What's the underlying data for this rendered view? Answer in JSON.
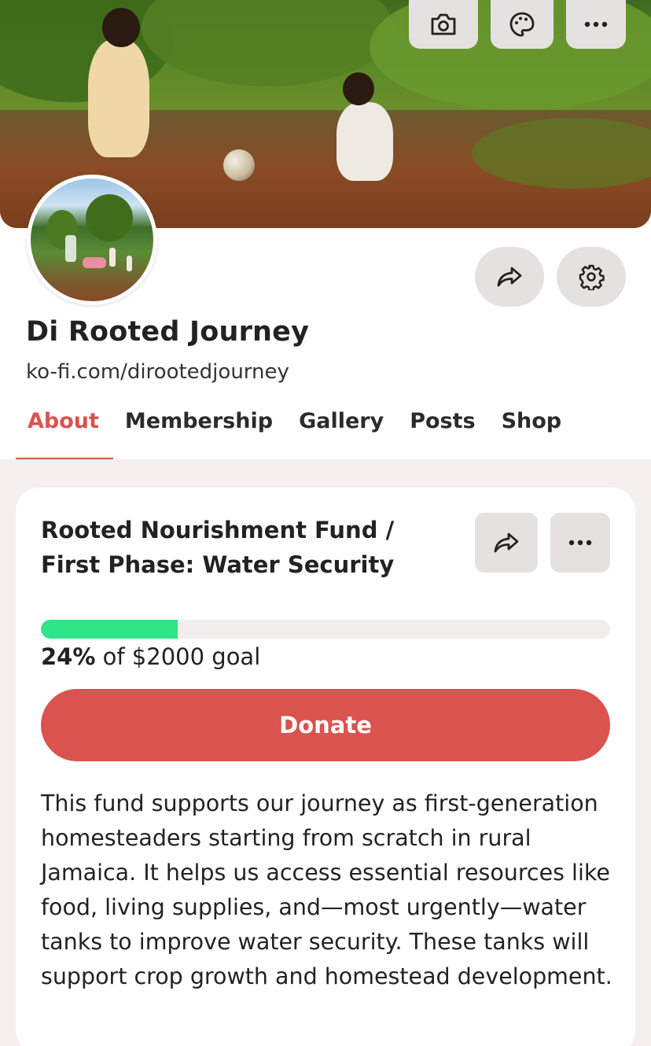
{
  "cover": {
    "actions": [
      {
        "icon": "camera-icon"
      },
      {
        "icon": "palette-icon"
      },
      {
        "icon": "more-icon"
      }
    ]
  },
  "profile": {
    "name": "Di Rooted Journey",
    "url": "ko-fi.com/dirootedjourney",
    "actions": [
      {
        "icon": "share-icon"
      },
      {
        "icon": "gear-icon"
      }
    ]
  },
  "tabs": [
    {
      "label": "About",
      "active": true
    },
    {
      "label": "Membership",
      "active": false
    },
    {
      "label": "Gallery",
      "active": false
    },
    {
      "label": "Posts",
      "active": false
    },
    {
      "label": "Shop",
      "active": false
    }
  ],
  "goal": {
    "title": "Rooted Nourishment Fund / First Phase: Water Security",
    "percent_label": "24%",
    "percent": 24,
    "goal_text": " of $2000 goal",
    "donate_label": "Donate",
    "description": "This fund supports our journey as first-generation homesteaders starting from scratch in rural Jamaica. It helps us access essential resources like food, living supplies, and—most urgently—water tanks to improve water security. These tanks will support crop growth and homestead development."
  },
  "colors": {
    "accent": "#d9534f",
    "progress": "#2ee587",
    "button_bg": "#e6e1e1",
    "page_bg": "#f5efef"
  }
}
